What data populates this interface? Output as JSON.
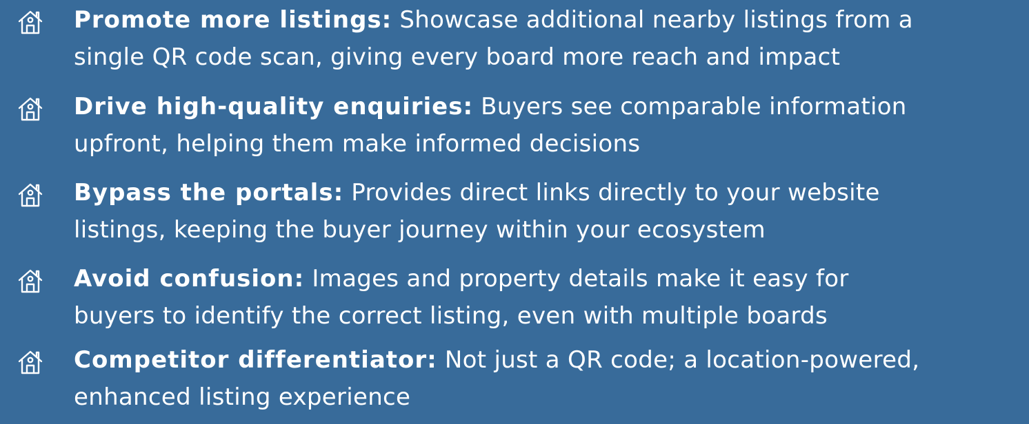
{
  "features": [
    {
      "icon": "house-icon",
      "title": "Promote more listings:",
      "line1": "Showcase additional nearby listings from a",
      "line2": "single QR code scan, giving every board more reach and impact"
    },
    {
      "icon": "house-icon",
      "title": "Drive high-quality enquiries:",
      "line1": "Buyers see comparable information",
      "line2": "upfront, helping them make informed decisions"
    },
    {
      "icon": "house-icon",
      "title": "Bypass the portals:",
      "line1": "Provides direct links directly to your website",
      "line2": "listings, keeping the buyer journey within your ecosystem"
    },
    {
      "icon": "house-icon",
      "title": "Avoid confusion:",
      "line1": "Images and property details make it easy for",
      "line2": "buyers to identify the correct listing, even with multiple boards"
    },
    {
      "icon": "house-icon",
      "title": "Competitor differentiator:",
      "line1": "Not just a QR code; a location-powered,",
      "line2": "enhanced listing experience"
    }
  ]
}
